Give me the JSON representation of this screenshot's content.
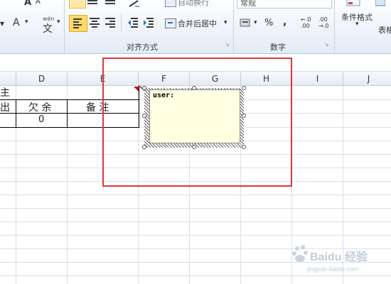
{
  "ribbon": {
    "font_bold": "A",
    "font_a_small": "A",
    "font_color_a": "A",
    "wen_label": "wén",
    "wen_char": "文",
    "wrap_text": "自动换行",
    "merge_center": "合并后居中",
    "number_format": "常规",
    "percent": "%",
    "comma": ",",
    "dec_increase": "+.0\n.00",
    "conditional_format": "条件格式",
    "table_format": "表格",
    "group_alignment": "对齐方式",
    "group_number": "数字"
  },
  "sheet": {
    "columns": [
      "D",
      "E",
      "F",
      "G",
      "H",
      "I",
      "J"
    ],
    "cells": {
      "row1_left": "主",
      "row2_left": "出",
      "row2_d": "欠 余",
      "row2_e": "备  注",
      "row3_d": "0"
    },
    "comment_text": "user:"
  },
  "watermark": {
    "brand": "Baidu 经验",
    "url": "jingyan.baidu.com"
  }
}
